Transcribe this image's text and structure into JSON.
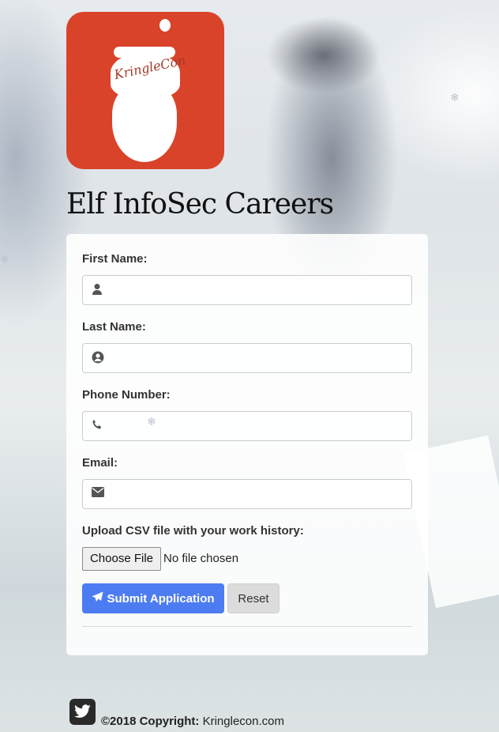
{
  "logo": {
    "text": "KringleCon"
  },
  "page": {
    "title": "Elf InfoSec Careers"
  },
  "form": {
    "first_name": {
      "label": "First Name:",
      "icon": "user-icon",
      "value": ""
    },
    "last_name": {
      "label": "Last Name:",
      "icon": "user-circle-icon",
      "value": ""
    },
    "phone": {
      "label": "Phone Number:",
      "icon": "phone-icon",
      "value": ""
    },
    "email": {
      "label": "Email:",
      "icon": "envelope-icon",
      "value": ""
    },
    "upload": {
      "label": "Upload CSV file with your work history:",
      "button": "Choose File",
      "status": "No file chosen"
    },
    "submit_label": "Submit Application",
    "reset_label": "Reset"
  },
  "footer": {
    "copyright_bold": "©2018 Copyright:",
    "copyright_site": "Kringlecon.com",
    "social_icon": "twitter-icon"
  },
  "colors": {
    "accent": "#4d7cf2",
    "logo_bg": "#d9432a"
  }
}
